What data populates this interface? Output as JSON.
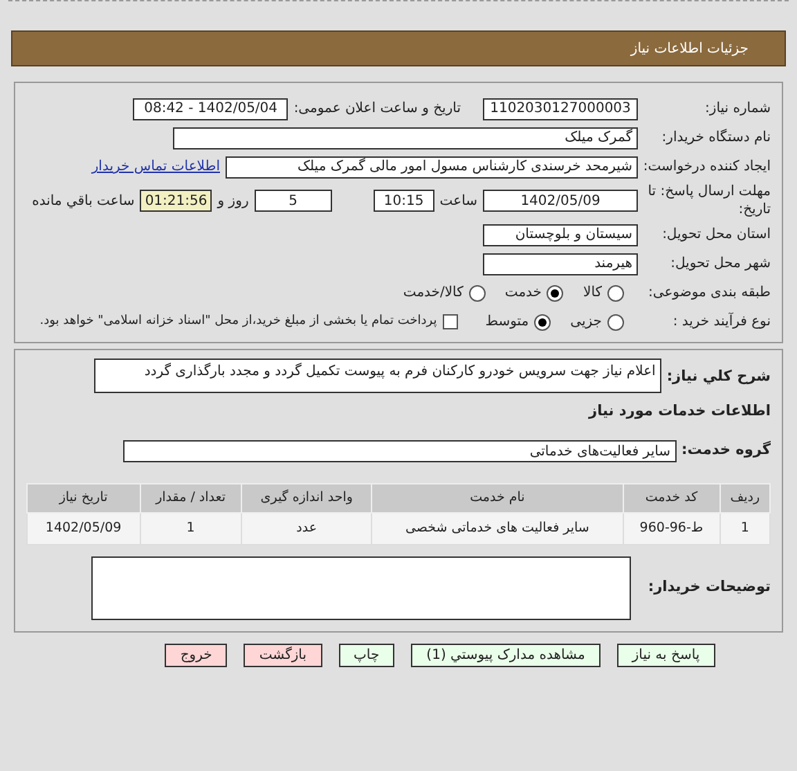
{
  "header": {
    "title": "جزئیات اطلاعات نیاز"
  },
  "need_number": {
    "label": "شماره نیاز:",
    "value": "1102030127000003"
  },
  "announce": {
    "label": "تاریخ و ساعت اعلان عمومی:",
    "value": "1402/05/04 - 08:42"
  },
  "buyer": {
    "label": "نام دستگاه خریدار:",
    "value": "گمرک میلک"
  },
  "requester": {
    "label": "ایجاد کننده درخواست:",
    "value": "شیرمحد خرسندی کارشناس مسول امور مالی گمرک میلک",
    "link": "اطلاعات تماس خریدار"
  },
  "deadline": {
    "label": "مهلت ارسال پاسخ: تا تاریخ:",
    "date": "1402/05/09",
    "time_label": "ساعت",
    "time": "10:15",
    "days": "5",
    "days_label": "روز و",
    "remaining": "01:21:56",
    "remaining_label": "ساعت باقي مانده"
  },
  "province": {
    "label": "استان محل تحویل:",
    "value": "سیستان و بلوچستان"
  },
  "city": {
    "label": "شهر محل تحویل:",
    "value": "هیرمند"
  },
  "category": {
    "label": "طبقه بندی موضوعی:",
    "options": [
      {
        "label": "کالا",
        "selected": false
      },
      {
        "label": "خدمت",
        "selected": true
      },
      {
        "label": "کالا/خدمت",
        "selected": false
      }
    ]
  },
  "process": {
    "label": "نوع فرآیند خرید :",
    "options": [
      {
        "label": "جزیی",
        "selected": false
      },
      {
        "label": "متوسط",
        "selected": true
      }
    ],
    "payment": {
      "checked": false,
      "label": "پرداخت تمام یا بخشی از مبلغ خرید،از محل \"اسناد خزانه اسلامی\" خواهد بود."
    }
  },
  "description": {
    "label": "شرح کلي نياز:",
    "value": "اعلام نیاز جهت سرویس خودرو کارکنان  فرم به پیوست تکمیل گردد و مجدد بارگذاری گردد"
  },
  "services_heading": "اطلاعات خدمات مورد نیاز",
  "service_group": {
    "label": "گروه خدمت:",
    "value": "سایر فعالیت‌های خدماتی"
  },
  "table": {
    "columns": [
      "ردیف",
      "کد خدمت",
      "نام خدمت",
      "واحد اندازه گیری",
      "تعداد / مقدار",
      "تاریخ نیاز"
    ],
    "rows": [
      [
        "1",
        "ط-96-960",
        "سایر فعالیت های خدماتی شخصی",
        "عدد",
        "1",
        "1402/05/09"
      ]
    ]
  },
  "buyer_notes": {
    "label": "توضیحات خریدار:"
  },
  "buttons": [
    {
      "label": "پاسخ به نیاز",
      "kind": "action"
    },
    {
      "label": "مشاهده مدارک پیوستي (1)",
      "kind": "action"
    },
    {
      "label": "چاپ",
      "kind": "action"
    },
    {
      "label": "بازگشت",
      "kind": "exit"
    },
    {
      "label": "خروج",
      "kind": "exit"
    }
  ]
}
